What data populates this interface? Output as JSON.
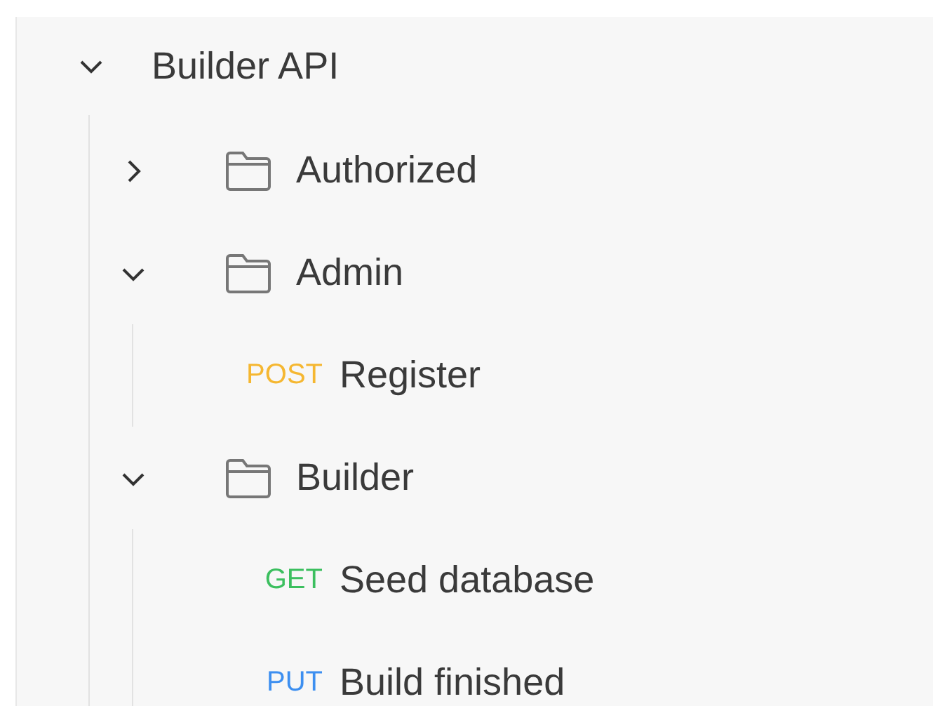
{
  "tree": {
    "label": "Builder API",
    "expanded": true,
    "children": [
      {
        "kind": "folder",
        "label": "Authorized",
        "expanded": false
      },
      {
        "kind": "folder",
        "label": "Admin",
        "expanded": true,
        "children": [
          {
            "kind": "request",
            "method": "POST",
            "color": "#f5b731",
            "label": "Register"
          }
        ]
      },
      {
        "kind": "folder",
        "label": "Builder",
        "expanded": true,
        "children": [
          {
            "kind": "request",
            "method": "GET",
            "color": "#3cbf5f",
            "label": "Seed database"
          },
          {
            "kind": "request",
            "method": "PUT",
            "color": "#3d8ff0",
            "label": "Build finished"
          }
        ]
      }
    ]
  }
}
